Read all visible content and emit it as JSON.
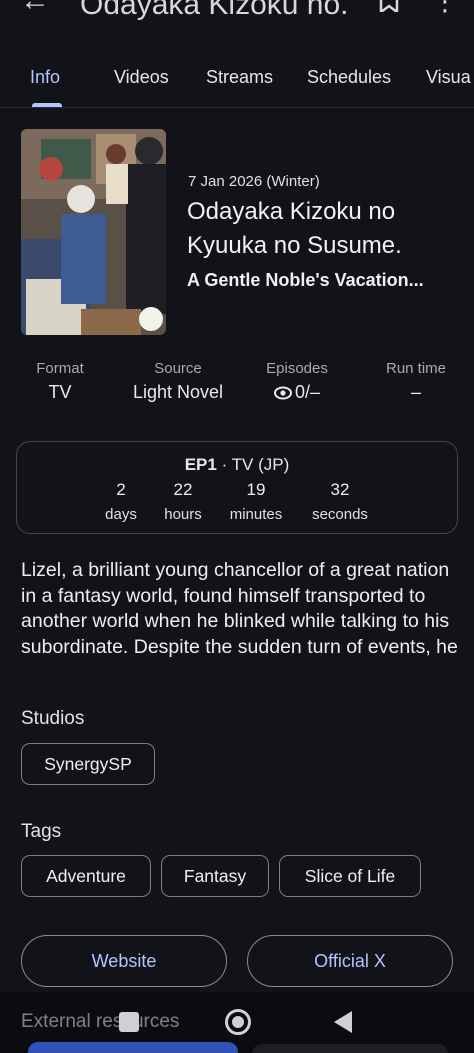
{
  "header": {
    "back_icon": "arrow-left-icon",
    "title": "Odayaka Kizoku no...",
    "bookmark_icon": "bookmark-icon",
    "more_icon": "more-vertical-icon"
  },
  "tabs": [
    {
      "label": "Info",
      "active": true
    },
    {
      "label": "Videos",
      "active": false
    },
    {
      "label": "Streams",
      "active": false
    },
    {
      "label": "Schedules",
      "active": false
    },
    {
      "label": "Visua",
      "active": false
    }
  ],
  "anime": {
    "date": "7 Jan 2026 (Winter)",
    "title": "Odayaka Kizoku no Kyuuka no Susume.",
    "subtitle": "A Gentle Noble's Vacation..."
  },
  "info": [
    {
      "label": "Format",
      "value": "TV"
    },
    {
      "label": "Source",
      "value": "Light Novel"
    },
    {
      "label": "Episodes",
      "value": "0/–",
      "icon": "eye-icon"
    },
    {
      "label": "Run time",
      "value": "–"
    }
  ],
  "countdown": {
    "episode": "EP1",
    "separator": " · ",
    "network": "TV (JP)",
    "units": [
      {
        "num": "2",
        "unit": "days"
      },
      {
        "num": "22",
        "unit": "hours"
      },
      {
        "num": "19",
        "unit": "minutes"
      },
      {
        "num": "32",
        "unit": "seconds"
      }
    ]
  },
  "description": "Lizel, a brilliant young chancellor of a great nation in a fantasy world, found himself transported to another world when he blinked while talking to his subordinate. Despite the sudden turn of events, he",
  "studios": {
    "title": "Studios",
    "items": [
      "SynergySP"
    ]
  },
  "tags": {
    "title": "Tags",
    "items": [
      "Adventure",
      "Fantasy",
      "Slice of Life"
    ]
  },
  "links": {
    "website": "Website",
    "official": "Official X"
  },
  "external": {
    "title": "External resources"
  },
  "colors": {
    "background": "#121318",
    "accent": "#b3c5ff"
  }
}
